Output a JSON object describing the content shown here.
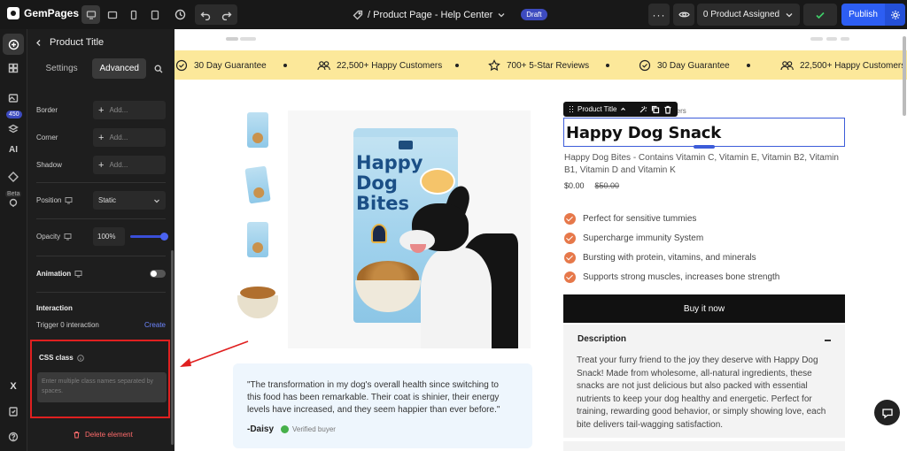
{
  "topbar": {
    "brand": "GemPages",
    "brand_version": "7",
    "breadcrumb": "/ Product Page - Help Center",
    "status": "Draft",
    "assigned": "0 Product Assigned",
    "publish": "Publish"
  },
  "rail": {
    "badge": "450",
    "beta": "Beta"
  },
  "panel": {
    "title": "Product Title",
    "tabs": [
      "Settings",
      "Advanced"
    ],
    "border_label": "Border",
    "corner_label": "Corner",
    "shadow_label": "Shadow",
    "add_label": "Add...",
    "position_label": "Position",
    "position_value": "Static",
    "opacity_label": "Opacity",
    "opacity_value": "100%",
    "opacity_level": 1.0,
    "animation_label": "Animation",
    "interaction_label": "Interaction",
    "trigger_text": "Trigger 0 interaction",
    "create_label": "Create",
    "css_class_label": "CSS class",
    "css_placeholder": "Enter multiple class names separated by spaces.",
    "delete_label": "Delete element"
  },
  "banner": {
    "items": [
      {
        "icon": "badge-check-icon",
        "text": "30 Day Guarantee"
      },
      {
        "icon": "users-icon",
        "text": "22,500+ Happy Customers"
      },
      {
        "icon": "star-icon",
        "text": "700+ 5-Star Reviews"
      },
      {
        "icon": "badge-check-icon",
        "text": "30 Day Guarantee"
      },
      {
        "icon": "users-icon",
        "text": "22,500+ Happy Customers"
      }
    ]
  },
  "product": {
    "bag_text": "Happy Dog Bites",
    "toolbar_label": "Product Title",
    "behind_text": "mers",
    "title": "Happy Dog Snack",
    "description": "Happy Dog Bites - Contains Vitamin C, Vitamin E, Vitamin B2, Vitamin B1, Vitamin D and Vitamin K",
    "price": "$0.00",
    "compare_price": "$50.00",
    "bullets": [
      "Perfect for sensitive tummies",
      "Supercharge immunity System",
      "Bursting with protein, vitamins, and minerals",
      "Supports strong muscles, increases bone strength"
    ],
    "buy_label": "Buy it now",
    "desc_title": "Description",
    "desc_body": "Treat your furry friend to the joy they deserve with Happy Dog Snack! Made from wholesome, all-natural ingredients, these snacks are not just delicious but also packed with essential nutrients to keep your dog healthy and energetic. Perfect for training, rewarding good behavior, or simply showing love, each bite delivers tail-wagging satisfaction."
  },
  "review": {
    "quote": "\"The transformation in my dog's overall health since switching to this food has been remarkable. Their coat is shinier, their energy levels have increased, and they seem happier than ever before.\"",
    "author": "-Daisy",
    "verified": "Verified buyer"
  },
  "colors": {
    "accent": "#2d5ef3",
    "highlight": "#e02020",
    "banner": "#fce89a",
    "bullet": "#e6784a"
  }
}
